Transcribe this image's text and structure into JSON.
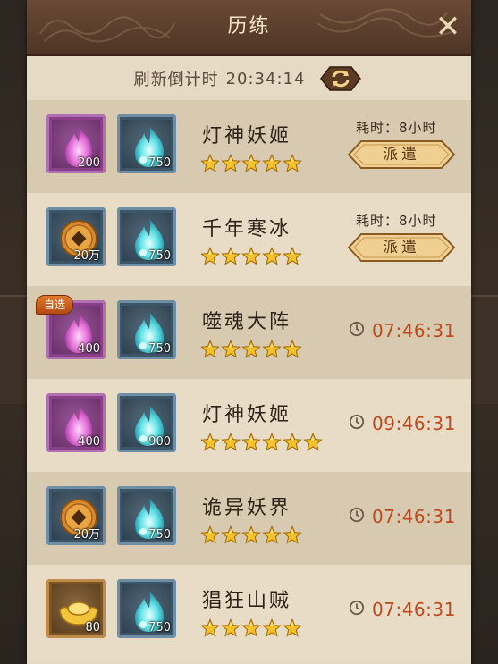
{
  "window": {
    "title": "历练"
  },
  "refresh": {
    "label": "刷新倒计时",
    "time": "20:34:14"
  },
  "tasks": [
    {
      "name": "灯神妖姬",
      "stars": 5,
      "auto": false,
      "rewards": [
        {
          "icon": "purple-flame-icon",
          "qty": "200",
          "frame": "purple"
        },
        {
          "icon": "blue-flame-icon",
          "qty": "750",
          "frame": "blue"
        }
      ],
      "duration": "耗时：8小时",
      "action": "派遣",
      "timer": ""
    },
    {
      "name": "千年寒冰",
      "stars": 5,
      "auto": false,
      "rewards": [
        {
          "icon": "copper-coin-icon",
          "qty": "20万",
          "frame": "blue"
        },
        {
          "icon": "blue-flame-icon",
          "qty": "750",
          "frame": "blue"
        }
      ],
      "duration": "耗时：8小时",
      "action": "派遣",
      "timer": ""
    },
    {
      "name": "噬魂大阵",
      "stars": 5,
      "auto": true,
      "auto_label": "自选",
      "rewards": [
        {
          "icon": "purple-flame-icon",
          "qty": "400",
          "frame": "purple"
        },
        {
          "icon": "blue-flame-icon",
          "qty": "750",
          "frame": "blue"
        }
      ],
      "duration": "",
      "action": "",
      "timer": "07:46:31"
    },
    {
      "name": "灯神妖姬",
      "stars": 6,
      "auto": false,
      "rewards": [
        {
          "icon": "purple-flame-icon",
          "qty": "400",
          "frame": "purple"
        },
        {
          "icon": "blue-flame-icon",
          "qty": "900",
          "frame": "blue"
        }
      ],
      "duration": "",
      "action": "",
      "timer": "09:46:31"
    },
    {
      "name": "诡异妖界",
      "stars": 5,
      "auto": false,
      "rewards": [
        {
          "icon": "copper-coin-icon",
          "qty": "20万",
          "frame": "blue"
        },
        {
          "icon": "blue-flame-icon",
          "qty": "750",
          "frame": "blue"
        }
      ],
      "duration": "",
      "action": "",
      "timer": "07:46:31"
    },
    {
      "name": "猖狂山贼",
      "stars": 5,
      "auto": false,
      "rewards": [
        {
          "icon": "gold-ingot-icon",
          "qty": "80",
          "frame": "brown"
        },
        {
          "icon": "blue-flame-icon",
          "qty": "750",
          "frame": "blue"
        }
      ],
      "duration": "",
      "action": "",
      "timer": "07:46:31"
    }
  ],
  "colors": {
    "timer": "#c0481a",
    "panel": "#e6dac4",
    "header": "#5a3d2c"
  }
}
